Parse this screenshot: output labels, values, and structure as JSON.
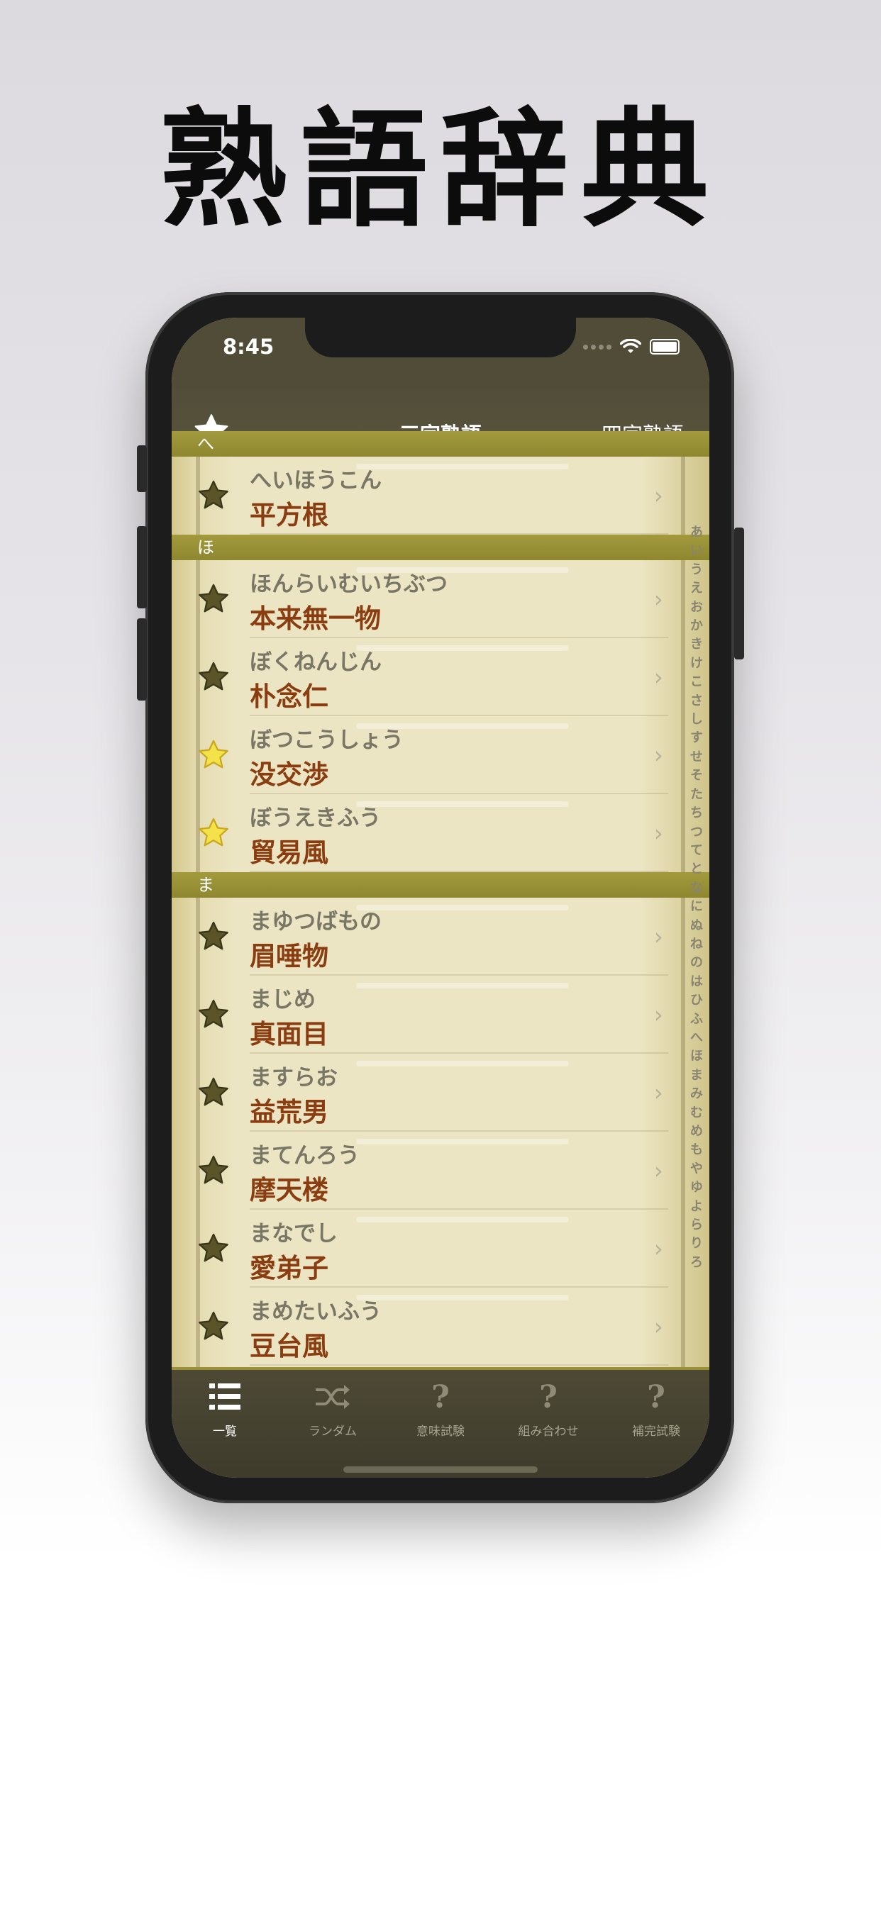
{
  "hero_title": "熟語辞典",
  "status": {
    "time": "8:45"
  },
  "nav": {
    "title": "三字熟語",
    "right": "四字熟語"
  },
  "sections": [
    {
      "header": "へ",
      "rows": [
        {
          "reading": "へいほうこん",
          "word": "平方根",
          "favorite": false
        }
      ]
    },
    {
      "header": "ほ",
      "rows": [
        {
          "reading": "ほんらいむいちぶつ",
          "word": "本来無一物",
          "favorite": false
        },
        {
          "reading": "ぼくねんじん",
          "word": "朴念仁",
          "favorite": false
        },
        {
          "reading": "ぼつこうしょう",
          "word": "没交渉",
          "favorite": true
        },
        {
          "reading": "ぼうえきふう",
          "word": "貿易風",
          "favorite": true
        }
      ]
    },
    {
      "header": "ま",
      "rows": [
        {
          "reading": "まゆつばもの",
          "word": "眉唾物",
          "favorite": false
        },
        {
          "reading": "まじめ",
          "word": "真面目",
          "favorite": false
        },
        {
          "reading": "ますらお",
          "word": "益荒男",
          "favorite": false
        },
        {
          "reading": "まてんろう",
          "word": "摩天楼",
          "favorite": false
        },
        {
          "reading": "まなでし",
          "word": "愛弟子",
          "favorite": false
        },
        {
          "reading": "まめたいふう",
          "word": "豆台風",
          "favorite": false
        }
      ]
    }
  ],
  "kana_index": [
    "あ",
    "い",
    "う",
    "え",
    "お",
    "か",
    "き",
    "け",
    "こ",
    "さ",
    "し",
    "す",
    "せ",
    "そ",
    "た",
    "ち",
    "つ",
    "て",
    "と",
    "な",
    "に",
    "ぬ",
    "ね",
    "の",
    "は",
    "ひ",
    "ふ",
    "へ",
    "ほ",
    "ま",
    "み",
    "む",
    "め",
    "も",
    "や",
    "ゆ",
    "よ",
    "ら",
    "り",
    "ろ"
  ],
  "tabs": [
    {
      "label": "一覧",
      "icon": "list-icon",
      "active": true
    },
    {
      "label": "ランダム",
      "icon": "shuffle-icon",
      "active": false
    },
    {
      "label": "意味試験",
      "icon": "question-icon",
      "active": false
    },
    {
      "label": "組み合わせ",
      "icon": "question-icon",
      "active": false
    },
    {
      "label": "補完試験",
      "icon": "question-icon",
      "active": false
    }
  ],
  "colors": {
    "section_header": "#9c9437",
    "word_text": "#8a3d10",
    "reading_text": "#7a7666",
    "star_off": "#5a5428",
    "star_on": "#f4e24a",
    "bar": "#514d38"
  }
}
